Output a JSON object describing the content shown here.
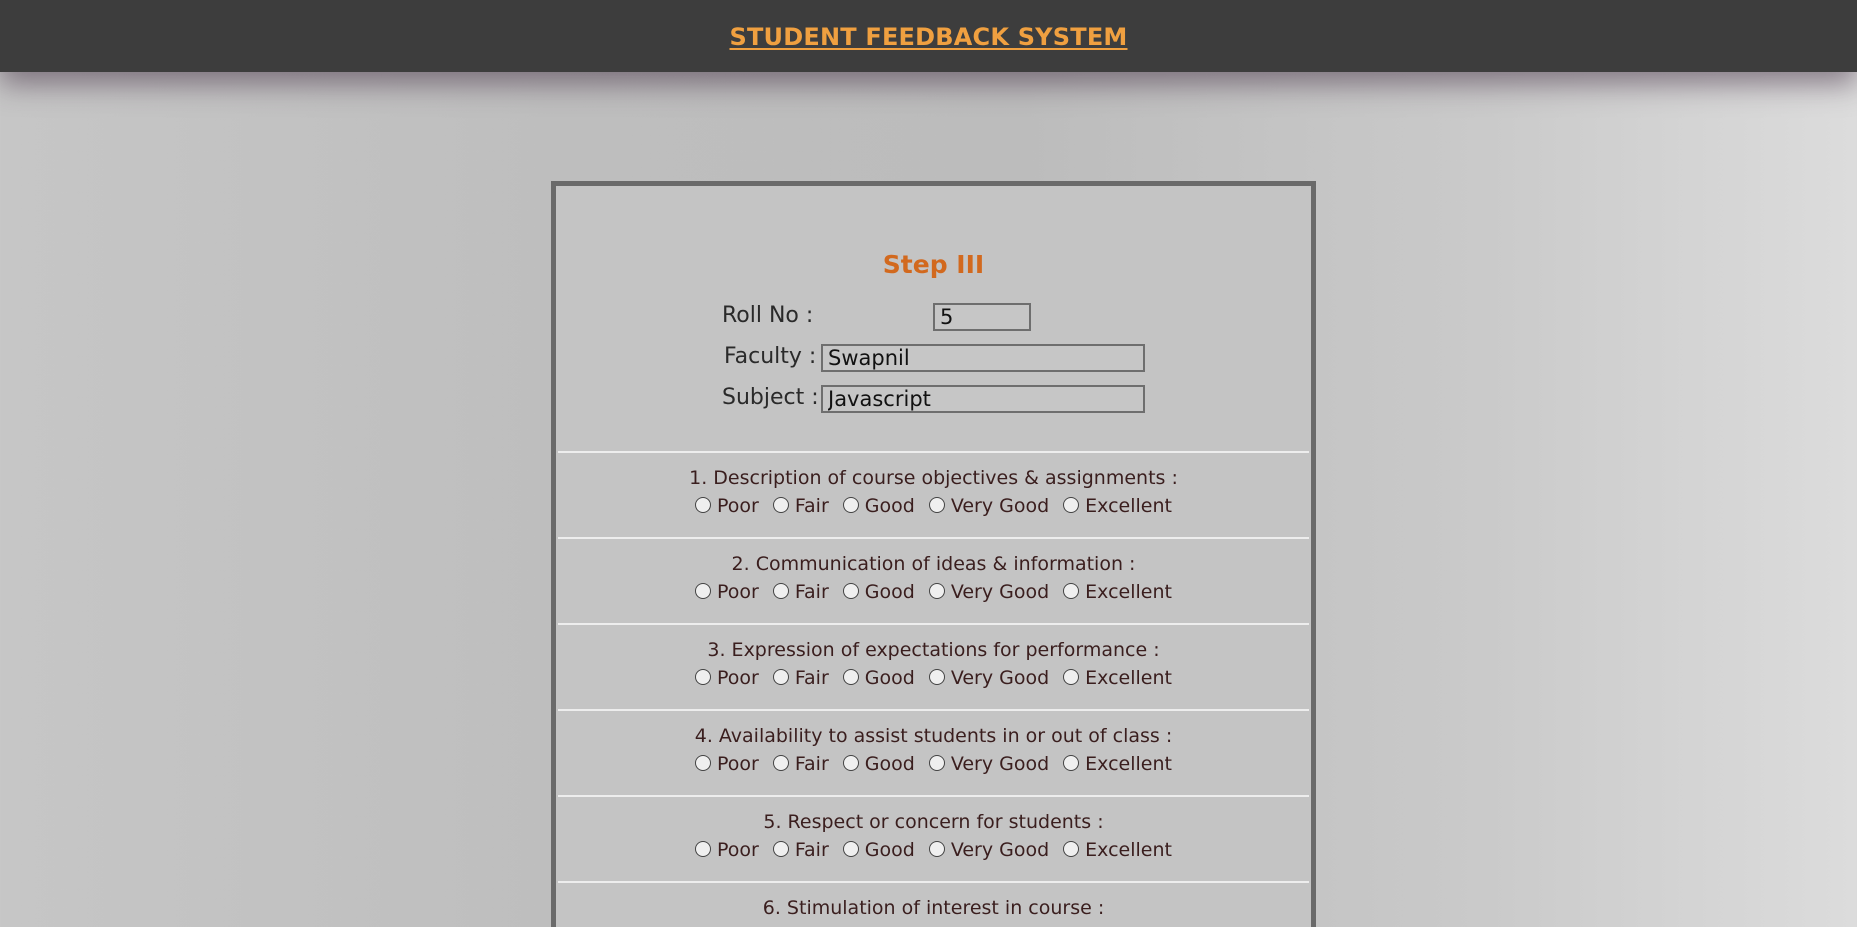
{
  "header": {
    "title": "STUDENT FEEDBACK SYSTEM"
  },
  "form": {
    "step_title": "Step III",
    "roll_no": {
      "label": "Roll No :",
      "value": "5"
    },
    "faculty": {
      "label": "Faculty :",
      "value": "Swapnil"
    },
    "subject": {
      "label": "Subject :",
      "value": "Javascript"
    },
    "rating_options": [
      "Poor",
      "Fair",
      "Good",
      "Very Good",
      "Excellent"
    ],
    "questions": [
      "1. Description of course objectives & assignments :",
      "2. Communication of ideas & information :",
      "3. Expression of expectations for performance :",
      "4. Availability to assist students in or out of class :",
      "5. Respect or concern for students :",
      "6. Stimulation of interest in course :"
    ]
  },
  "colors": {
    "header_bg": "#3d3d3d",
    "header_title": "#f0a040",
    "step_title": "#d2691e",
    "question_text": "#3a1e1e",
    "form_border": "#6a6a6a"
  }
}
